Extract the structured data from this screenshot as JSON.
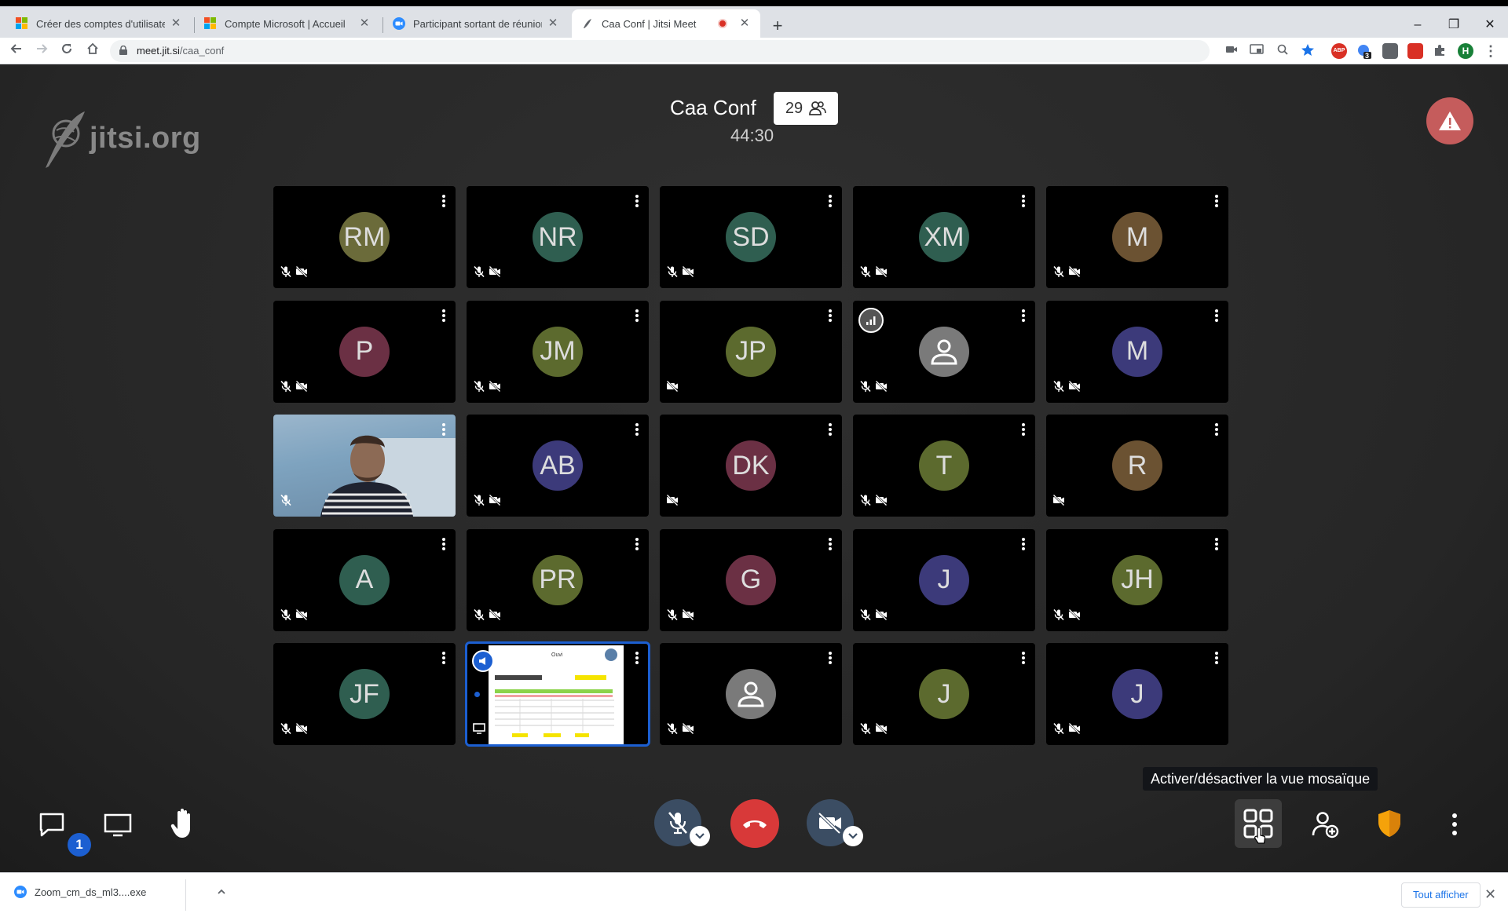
{
  "browser": {
    "tabs": [
      {
        "title": "Créer des comptes d'utilisateur d",
        "close": "✕"
      },
      {
        "title": "Compte Microsoft | Accueil",
        "close": "✕"
      },
      {
        "title": "Participant sortant de réunion - Z",
        "close": "✕"
      },
      {
        "title": "Caa Conf | Jitsi Meet",
        "close": "✕"
      }
    ],
    "new_tab": "+",
    "url_host": "meet.jit.si",
    "url_path": "/caa_conf",
    "window_controls": [
      "–",
      "❐",
      "✕"
    ],
    "profile_initial": "H",
    "ext_badge_count": "3",
    "abp_label": "ABP"
  },
  "meeting": {
    "watermark": "jitsi.org",
    "title": "Caa Conf",
    "participant_count": "29",
    "timer": "44:30",
    "tooltip": "Activer/désactiver la vue mosaïque",
    "chat_badge": "1",
    "tiles": [
      {
        "initials": "RM",
        "color": "#6b6b3a",
        "mic_muted": true,
        "cam_off": true
      },
      {
        "initials": "NR",
        "color": "#2f5e50",
        "mic_muted": true,
        "cam_off": true
      },
      {
        "initials": "SD",
        "color": "#2f5e50",
        "mic_muted": true,
        "cam_off": true
      },
      {
        "initials": "XM",
        "color": "#2f5e50",
        "mic_muted": true,
        "cam_off": true
      },
      {
        "initials": "M",
        "color": "#6b5232",
        "mic_muted": true,
        "cam_off": true
      },
      {
        "initials": "P",
        "color": "#6b3044",
        "mic_muted": true,
        "cam_off": true
      },
      {
        "initials": "JM",
        "color": "#5c6a2e",
        "mic_muted": true,
        "cam_off": true
      },
      {
        "initials": "JP",
        "color": "#5c6a2e",
        "mic_muted": false,
        "cam_off": true
      },
      {
        "initials": "",
        "color": "#7a7a7a",
        "mic_muted": true,
        "cam_off": true,
        "placeholder": true,
        "signal": true
      },
      {
        "initials": "M",
        "color": "#3c3a7a",
        "mic_muted": true,
        "cam_off": true
      },
      {
        "initials": "",
        "color": "",
        "mic_muted": true,
        "cam_off": false,
        "camera": true
      },
      {
        "initials": "AB",
        "color": "#3c3a7a",
        "mic_muted": true,
        "cam_off": true
      },
      {
        "initials": "DK",
        "color": "#6b3044",
        "mic_muted": false,
        "cam_off": true
      },
      {
        "initials": "T",
        "color": "#5c6a2e",
        "mic_muted": true,
        "cam_off": true
      },
      {
        "initials": "R",
        "color": "#6b5232",
        "mic_muted": false,
        "cam_off": true
      },
      {
        "initials": "A",
        "color": "#2f5e50",
        "mic_muted": true,
        "cam_off": true
      },
      {
        "initials": "PR",
        "color": "#5c6a2e",
        "mic_muted": true,
        "cam_off": true
      },
      {
        "initials": "G",
        "color": "#6b3044",
        "mic_muted": true,
        "cam_off": true
      },
      {
        "initials": "J",
        "color": "#3c3a7a",
        "mic_muted": true,
        "cam_off": true
      },
      {
        "initials": "JH",
        "color": "#5c6a2e",
        "mic_muted": true,
        "cam_off": true
      },
      {
        "initials": "JF",
        "color": "#2f5e50",
        "mic_muted": true,
        "cam_off": true
      },
      {
        "initials": "",
        "color": "",
        "mic_muted": false,
        "cam_off": false,
        "screenshare": true,
        "selected": true
      },
      {
        "initials": "",
        "color": "#7a7a7a",
        "mic_muted": true,
        "cam_off": true,
        "placeholder": true
      },
      {
        "initials": "J",
        "color": "#5c6a2e",
        "mic_muted": true,
        "cam_off": true
      },
      {
        "initials": "J",
        "color": "#3c3a7a",
        "mic_muted": true,
        "cam_off": true
      }
    ],
    "screen_title": "Ouvi"
  },
  "downloads": {
    "file": "Zoom_cm_ds_ml3....exe",
    "show_all": "Tout afficher",
    "close": "✕"
  }
}
